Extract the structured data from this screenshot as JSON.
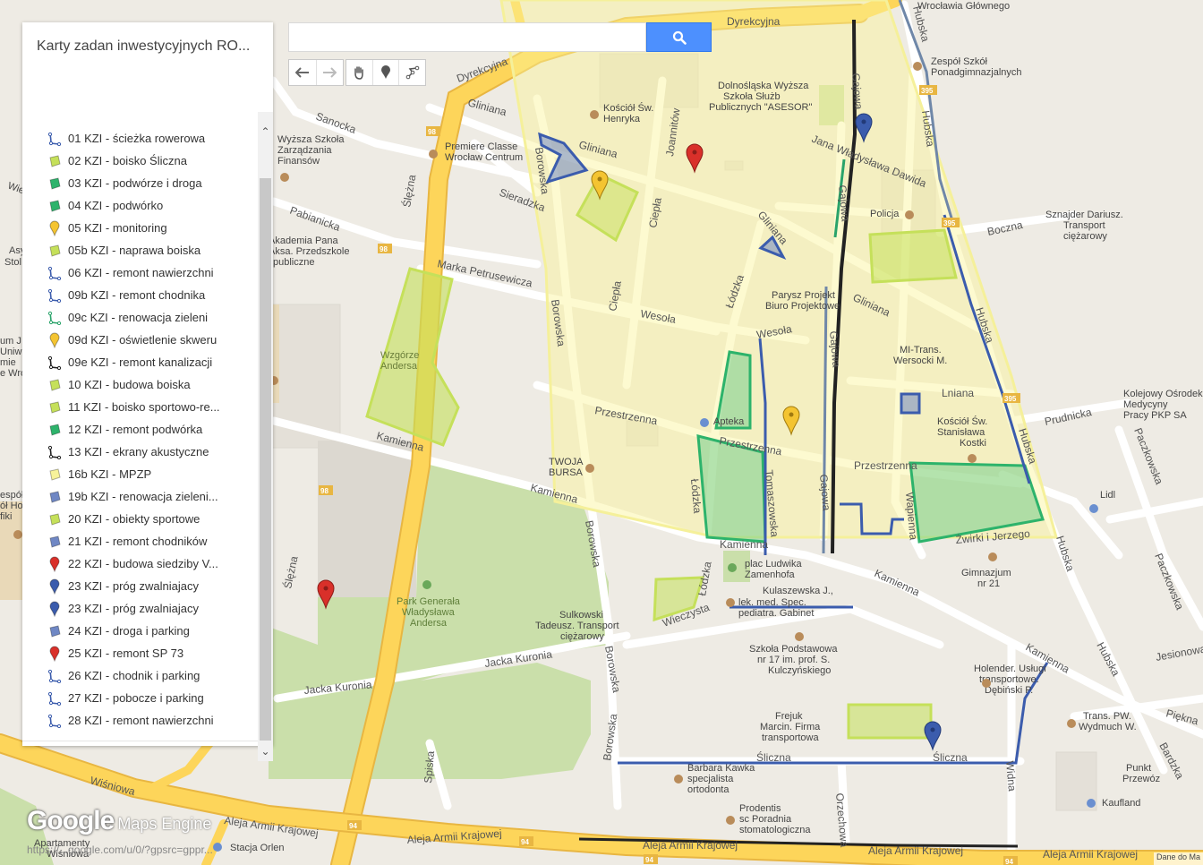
{
  "panel": {
    "title": "Karty zadan inwestycyjnych RO...",
    "layers": [
      {
        "label": "01 KZI - ścieżka rowerowa",
        "icon": "line-icon",
        "color": "#3b5cad"
      },
      {
        "label": "02 KZI - boisko Śliczna",
        "icon": "polygon-icon",
        "color": "#c5e05a"
      },
      {
        "label": "03 KZI - podwórze i droga",
        "icon": "polygon-icon",
        "color": "#2db36b"
      },
      {
        "label": "04 KZI - podwórko",
        "icon": "polygon-icon",
        "color": "#2db36b"
      },
      {
        "label": "05 KZI - monitoring",
        "icon": "marker-icon",
        "color": "#f4c431"
      },
      {
        "label": "05b KZI - naprawa boiska",
        "icon": "polygon-icon",
        "color": "#c5e05a"
      },
      {
        "label": "06 KZI - remont nawierzchni",
        "icon": "line-icon",
        "color": "#3b5cad"
      },
      {
        "label": "09b KZI - remont chodnika",
        "icon": "line-icon",
        "color": "#3b5cad"
      },
      {
        "label": "09c KZI - renowacja zieleni",
        "icon": "line-icon",
        "color": "#2aa36a"
      },
      {
        "label": "09d KZI - oświetlenie skweru",
        "icon": "marker-icon",
        "color": "#f4c431"
      },
      {
        "label": "09e KZI - remont kanalizacji",
        "icon": "line-icon",
        "color": "#222222"
      },
      {
        "label": "10 KZI - budowa boiska",
        "icon": "polygon-icon",
        "color": "#c5e05a"
      },
      {
        "label": "11 KZI - boisko sportowo-re...",
        "icon": "polygon-icon",
        "color": "#c5e05a"
      },
      {
        "label": "12 KZI -  remont podwórka",
        "icon": "polygon-icon",
        "color": "#2db36b"
      },
      {
        "label": "13 KZI -  ekrany akustyczne",
        "icon": "line-icon",
        "color": "#222222"
      },
      {
        "label": "16b KZI - MPZP",
        "icon": "polygon-icon",
        "color": "#f7f29a"
      },
      {
        "label": "19b KZI - renowacja zieleni...",
        "icon": "polygon-icon",
        "color": "#6f87c4"
      },
      {
        "label": "20 KZI - obiekty sportowe",
        "icon": "polygon-icon",
        "color": "#c5e05a"
      },
      {
        "label": "21 KZI - remont chodników",
        "icon": "polygon-icon",
        "color": "#6f87c4"
      },
      {
        "label": "22 KZI -  budowa siedziby V...",
        "icon": "marker-icon",
        "color": "#d9302a"
      },
      {
        "label": "23 KZI - próg zwalniajacy",
        "icon": "marker-icon",
        "color": "#3b5cad"
      },
      {
        "label": "23 KZI - próg zwalniajacy",
        "icon": "marker-icon",
        "color": "#3b5cad"
      },
      {
        "label": "24 KZI -  droga i parking",
        "icon": "polygon-icon",
        "color": "#6f87c4"
      },
      {
        "label": "25 KZI - remont SP 73",
        "icon": "marker-icon",
        "color": "#d9302a"
      },
      {
        "label": "26 KZI - chodnik i parking",
        "icon": "line-icon",
        "color": "#3b5cad"
      },
      {
        "label": "27 KZI - pobocze i parking",
        "icon": "line-icon",
        "color": "#3b5cad"
      },
      {
        "label": "28 KZI - remont nawierzchni",
        "icon": "line-icon",
        "color": "#3b5cad"
      }
    ]
  },
  "search": {
    "value": "",
    "placeholder": ""
  },
  "toolbar": {
    "undo": "undo-icon",
    "redo": "redo-icon",
    "pan": "hand-icon",
    "marker": "marker-icon",
    "line": "draw-line-icon"
  },
  "map": {
    "streets": {
      "dyrekcyjna_1": "Dyrekcyjna",
      "dyrekcyjna_2": "Dyrekcyjna",
      "gliniana_1": "Gliniana",
      "gliniana_2": "Gliniana",
      "gliniana_3": "Gliniana",
      "gliniana_4": "Gliniana",
      "sanocka": "Sanocka",
      "pabianicka": "Pabianicka",
      "sieradzka": "Sieradzka",
      "marka_petrusewicza": "Marka Petrusewicza",
      "slezna_1": "Ślężna",
      "slezna_2": "Ślężna",
      "borowska_1": "Borowska",
      "borowska_2": "Borowska",
      "borowska_3": "Borowska",
      "borowska_4": "Borowska",
      "borowska_5": "Borowska",
      "kamienna_1": "Kamienna",
      "kamienna_2": "Kamienna",
      "kamienna_3": "Kamienna",
      "kamienna_4": "Kamienna",
      "kamienna_5": "Kamienna",
      "wesola_1": "Wesoła",
      "wesola_2": "Wesoła",
      "przestrzenna_1": "Przestrzenna",
      "przestrzenna_2": "Przestrzenna",
      "przestrzenna_3": "Przestrzenna",
      "ciepla_1": "Ciepła",
      "ciepla_2": "Ciepła",
      "lodzka_1": "Łódzka",
      "lodzka_2": "Łódzka",
      "lodzka_3": "Łódzka",
      "joannitow": "Joannitów",
      "gajowa_1": "Gajowa",
      "gajowa_2": "Gajowa",
      "gajowa_3": "Gajowa",
      "gajowa_4": "Gajowa",
      "jana_wladyslawa_dawida": "Jana Władysława Dawida",
      "hubska_1": "Hubska",
      "hubska_2": "Hubska",
      "hubska_3": "Hubska",
      "hubska_4": "Hubska",
      "hubska_5": "Hubska",
      "hubska_6": "Hubska",
      "hubska_7": "Hubska",
      "boczna": "Boczna",
      "lniana": "Lniana",
      "prudnicka": "Prudnicka",
      "paczkowska_1": "Paczkowska",
      "paczkowska_2": "Paczkowska",
      "jesionowa": "Jesionowa",
      "piekna": "Piękna",
      "bardzka": "Bardzka",
      "tomaszowska": "Tomaszowska",
      "wapienna": "Wapienna",
      "zwirki_jerzego": "Żwirki i Jerzego",
      "wieczysta": "Wieczysta",
      "jacka_kuronia_1": "Jacka Kuronia",
      "jacka_kuronia_2": "Jacka Kuronia",
      "spiska": "Spiska",
      "sliczna_1": "Śliczna",
      "sliczna_2": "Śliczna",
      "orzechowa": "Orzechowa",
      "widna": "Widna",
      "aleja_armii_krajowej_1": "Aleja Armii Krajowej",
      "aleja_armii_krajowej_2": "Aleja Armii Krajowej",
      "aleja_armii_krajowej_3": "Aleja Armii Krajowej",
      "aleja_armii_krajowej_4": "Aleja Armii Krajowej",
      "aleja_armii_krajowej_5": "Aleja Armii Krajowej",
      "wisniowa": "Wiśniowa"
    },
    "shields": {
      "r98_1": "98",
      "r98_2": "98",
      "r98_3": "98",
      "r395_1": "395",
      "r395_2": "395",
      "r395_3": "395",
      "r94_1": "94",
      "r94_2": "94",
      "r94_3": "94",
      "r94_4": "94"
    },
    "places": {
      "wroclaw_glownego": "Wrocławia Głównego",
      "zespol_szkol_1": "Zespół Szkół",
      "zespol_szkol_2": "Ponadgimnazjalnych",
      "dolnoslaska_1": "Dolnośląska Wyższa",
      "dolnoslaska_2": "Szkoła Służb",
      "dolnoslaska_3": "Publicznych \"ASESOR\"",
      "kosciol_henryka_1": "Kościół Św.",
      "kosciol_henryka_2": "Henryka",
      "premiere_1": "Premiere Classe",
      "premiere_2": "Wrocław Centrum",
      "wyzsza_1": "Wyższa Szkoła",
      "wyzsza_2": "Zarządzania",
      "wyzsza_3": "Finansów",
      "akademia_1": "Akademia Pana",
      "akademia_2": "Aksa. Przedszkole",
      "akademia_3": "publiczne",
      "policja": "Policja",
      "sznajder_1": "Sznajder Dariusz.",
      "sznajder_2": "Transport",
      "sznajder_3": "ciężarowy",
      "parysz_1": "Parysz Projekt",
      "parysz_2": "Biuro Projektowe",
      "mitrans_1": "MI-Trans.",
      "mitrans_2": "Wersocki M.",
      "kolejowy_1": "Kolejowy Ośrodek",
      "kolejowy_2": "Medycyny",
      "kolejowy_3": "Pracy PKP SA",
      "kosciol_stanislawa_1": "Kościół Św.",
      "kosciol_stanislawa_2": "Stanisława",
      "kosciol_stanislawa_3": "Kostki",
      "wzgorze_1": "Wzgórze",
      "wzgorze_2": "Andersa",
      "apteka": "Apteka",
      "twoja_bursa_1": "TWOJA",
      "twoja_bursa_2": "BURSA",
      "lidl": "Lidl",
      "plac_zamenhofa_1": "plac Ludwika",
      "plac_zamenhofa_2": "Zamenhofa",
      "gimnazjum_1": "Gimnazjum",
      "gimnazjum_2": "nr 21",
      "kulaszewska_1": "Kulaszewska J.,",
      "kulaszewska_2": "lek. med. Spec.",
      "kulaszewska_3": "pediatra. Gabinet",
      "park_1": "Park Generała",
      "park_2": "Władysława",
      "park_3": "Andersa",
      "sulkowski_1": "Sulkowski",
      "sulkowski_2": "Tadeusz. Transport",
      "sulkowski_3": "ciężarowy",
      "szkola_1": "Szkoła Podstawowa",
      "szkola_2": "nr 17 im. prof. S.",
      "szkola_3": "Kulczyńskiego",
      "holender_1": "Holender. Usługi",
      "holender_2": "transportowe.",
      "holender_3": "Dębiński P.",
      "transpw_1": "Trans. PW.",
      "transpw_2": "Wydmuch W.",
      "frejuk_1": "Frejuk",
      "frejuk_2": "Marcin. Firma",
      "frejuk_3": "transportowa",
      "barbara_1": "Barbara Kawka",
      "barbara_2": "specjalista",
      "barbara_3": "ortodonta",
      "punkt_1": "Punkt",
      "punkt_2": "Przewóz",
      "kaufland": "Kaufland",
      "prodentis_1": "Prodentis",
      "prodentis_2": "sc Poradnia",
      "prodentis_3": "stomatologiczna",
      "stacja_orlen": "Stacja Orlen",
      "apartamenty_1": "Apartamenty",
      "apartamenty_2": "Wiśniowa",
      "left_1": "Asy",
      "left_2": "Stol",
      "left_3": "um J",
      "left_4": "Uniwe",
      "left_5": "mie",
      "left_6": "e Wro",
      "left_7": "espół",
      "left_8": "ół Ho",
      "left_9": "fiki",
      "left_10": "Wie"
    }
  },
  "watermark": {
    "logo": "Google",
    "product": "Maps Engine"
  },
  "status_url": "https://...google.com/u/0/?gpsrc=gppr...",
  "attribution": "Dane do Ma"
}
